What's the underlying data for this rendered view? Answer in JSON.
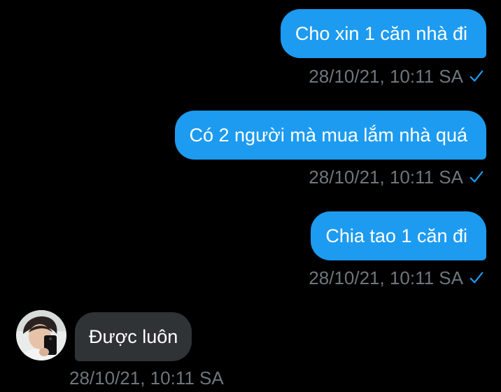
{
  "colors": {
    "background": "#000000",
    "outgoing_bubble": "#1d9bf0",
    "incoming_bubble": "#2f3336",
    "timestamp": "#6e767d",
    "check": "#1d9bf0"
  },
  "messages": [
    {
      "direction": "outgoing",
      "text": "Cho xin 1 căn nhà đi",
      "timestamp": "28/10/21, 10:11 SA",
      "status_icon": "check-icon"
    },
    {
      "direction": "outgoing",
      "text": "Có 2 người mà mua lắm nhà quá",
      "timestamp": "28/10/21, 10:11 SA",
      "status_icon": "check-icon"
    },
    {
      "direction": "outgoing",
      "text": "Chia tao 1 căn đi",
      "timestamp": "28/10/21, 10:11 SA",
      "status_icon": "check-icon"
    },
    {
      "direction": "incoming",
      "text": "Được luôn",
      "timestamp": "28/10/21, 10:11 SA",
      "avatar": "avatar-icon"
    }
  ]
}
